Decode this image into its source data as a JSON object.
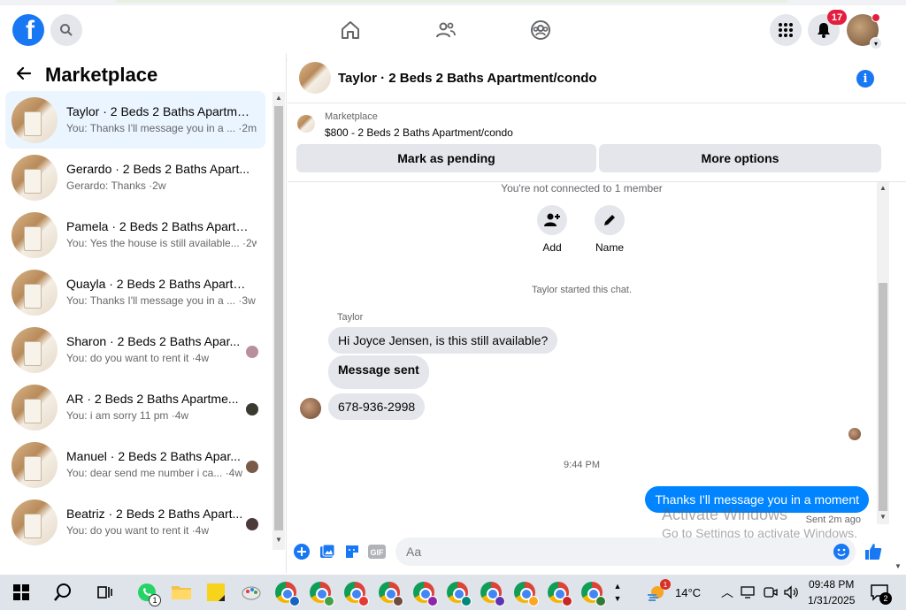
{
  "topbar": {
    "logo": "f",
    "notifications_count": "17",
    "icons": [
      "facebook-logo",
      "search-icon",
      "home-icon",
      "friends-icon",
      "groups-icon",
      "menu-grid-icon",
      "bell-icon",
      "profile-avatar"
    ]
  },
  "left_panel": {
    "title": "Marketplace",
    "conversations": [
      {
        "name": "Taylor · 2 Beds 2 Baths Apartme...",
        "snippet": "You: Thanks I'll message you in a ... ·2m",
        "active": true
      },
      {
        "name": "Gerardo · 2 Beds 2 Baths Apart...",
        "snippet": "Gerardo: Thanks ·2w",
        "active": false
      },
      {
        "name": "Pamela · 2 Beds 2 Baths Apartm...",
        "snippet": "You: Yes the house is still available... ·2w",
        "active": false
      },
      {
        "name": "Quayla · 2 Beds 2 Baths Apartm...",
        "snippet": "You: Thanks I'll message you in a ... ·3w",
        "active": false
      },
      {
        "name": "Sharon · 2 Beds 2 Baths Apar...",
        "snippet": "You: do you want to rent it ·4w",
        "active": false
      },
      {
        "name": "AR · 2 Beds 2 Baths Apartme...",
        "snippet": "You: i am sorry 11 pm ·4w",
        "active": false
      },
      {
        "name": "Manuel · 2 Beds 2 Baths Apar...",
        "snippet": "You: dear send me number i ca... ·4w",
        "active": false
      },
      {
        "name": "Beatriz · 2 Beds 2 Baths Apart...",
        "snippet": "You: do you want to rent it ·4w",
        "active": false
      }
    ]
  },
  "chat": {
    "title": "Taylor · 2 Beds 2 Baths Apartment/condo",
    "listing_label": "Marketplace",
    "listing_price": "$800 - 2 Beds 2 Baths Apartment/condo",
    "mark_pending": "Mark as pending",
    "more_options": "More options",
    "not_connected": "You're not connected to 1 member",
    "add_label": "Add",
    "name_label": "Name",
    "started": "Taylor started this chat.",
    "sender": "Taylor",
    "messages": [
      "Hi Joyce Jensen, is this still available?",
      "Message sent",
      "678-936-2998"
    ],
    "time_divider": "9:44 PM",
    "my_message": "Thanks I'll message you in a moment",
    "sent_status": "Sent 2m ago",
    "composer_placeholder": "Aa",
    "watermark_title": "Activate Windows",
    "watermark_sub": "Go to Settings to activate Windows."
  },
  "taskbar": {
    "weather": "14°C",
    "weather_badge": "1",
    "time": "09:48 PM",
    "date": "1/31/2025",
    "notif_count": "2",
    "whatsapp_badge": "1"
  },
  "colors": {
    "brand": "#1877f2",
    "outgoing_bubble": "#0084ff",
    "incoming_bubble": "#e4e6eb",
    "badge": "#e41e3f"
  }
}
